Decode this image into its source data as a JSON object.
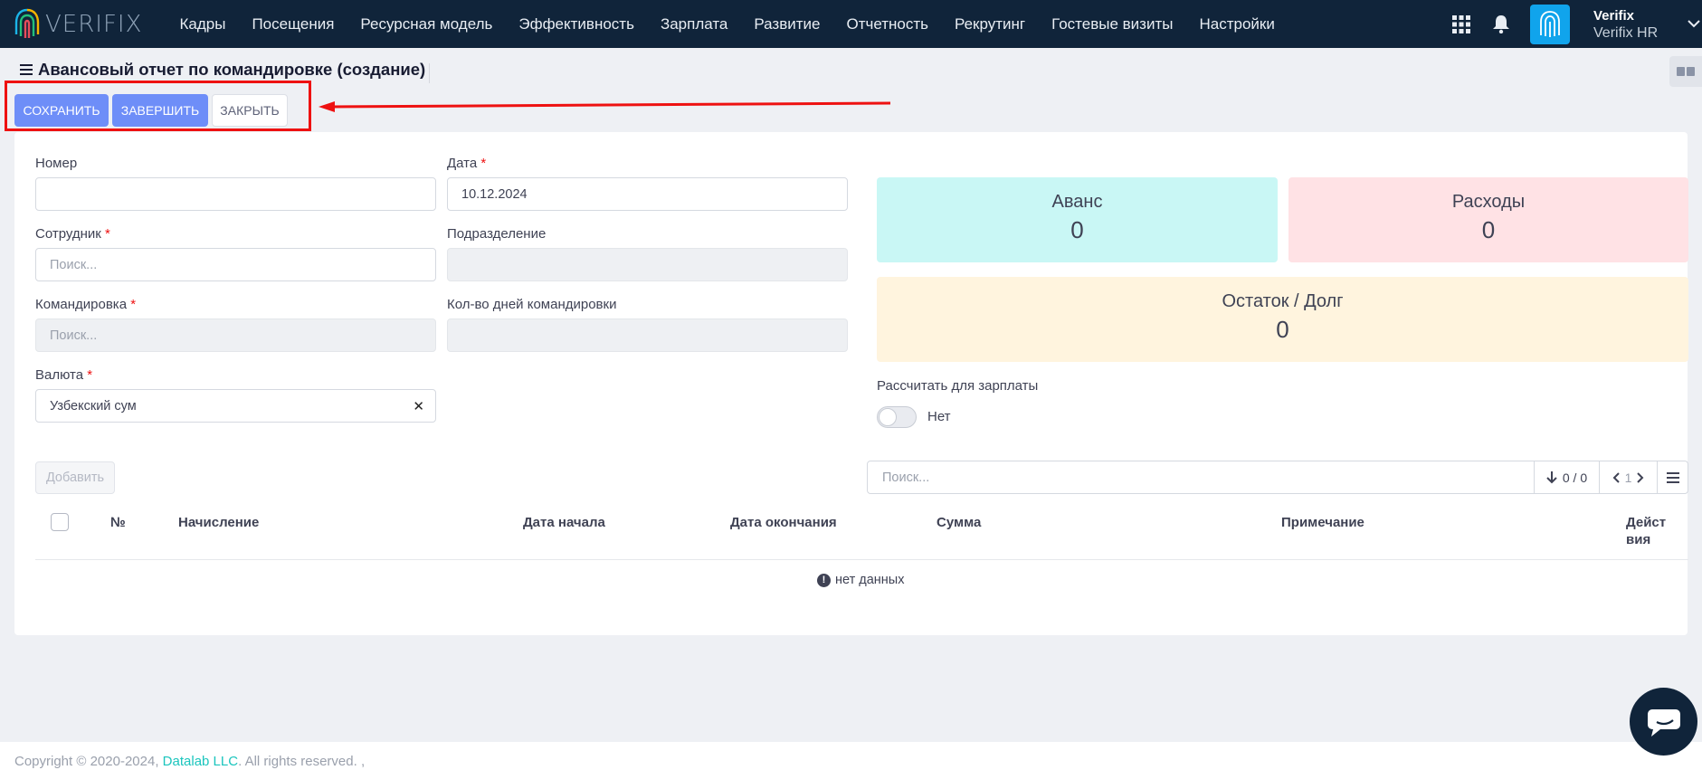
{
  "brand": {
    "name": "VERIFIX"
  },
  "nav": {
    "items": [
      "Кадры",
      "Посещения",
      "Ресурсная модель",
      "Эффективность",
      "Зарплата",
      "Развитие",
      "Отчетность",
      "Рекрутинг",
      "Гостевые визиты",
      "Настройки"
    ]
  },
  "user": {
    "name": "Verifix",
    "org": "Verifix HR"
  },
  "page": {
    "title": "Авансовый отчет по командировке (создание)"
  },
  "toolbar": {
    "save_label": "Сохранить",
    "finish_label": "Завершить",
    "close_label": "Закрыть"
  },
  "form": {
    "number": {
      "label": "Номер",
      "value": ""
    },
    "date": {
      "label": "Дата",
      "value": "10.12.2024"
    },
    "employee": {
      "label": "Сотрудник",
      "placeholder": "Поиск..."
    },
    "division": {
      "label": "Подразделение",
      "value": ""
    },
    "trip": {
      "label": "Командировка",
      "placeholder": "Поиск..."
    },
    "trip_days": {
      "label": "Кол-во дней командировки",
      "value": ""
    },
    "currency": {
      "label": "Валюта",
      "value": "Узбекский сум"
    },
    "required_mark": "*"
  },
  "stats": {
    "advance": {
      "title": "Аванс",
      "value": "0",
      "color": "#c9f7f5"
    },
    "expenses": {
      "title": "Расходы",
      "value": "0",
      "color": "#ffe2e5"
    },
    "balance": {
      "title": "Остаток / Долг",
      "value": "0",
      "color": "#fff4de"
    }
  },
  "salary_toggle": {
    "label": "Рассчитать для зарплаты",
    "state_label": "Нет"
  },
  "grid": {
    "add_label": "Добавить",
    "search_placeholder": "Поиск...",
    "count": "0 / 0",
    "page": "1",
    "columns": {
      "num": "№",
      "accrual": "Начисление",
      "start": "Дата начала",
      "end": "Дата окончания",
      "sum": "Сумма",
      "note": "Примечание",
      "actions": "Действия"
    },
    "empty_text": "нет данных"
  },
  "footer": {
    "copyright": "Copyright © 2020-2024,",
    "company": "Datalab LLC",
    "rights": ". All rights reserved. ,"
  }
}
